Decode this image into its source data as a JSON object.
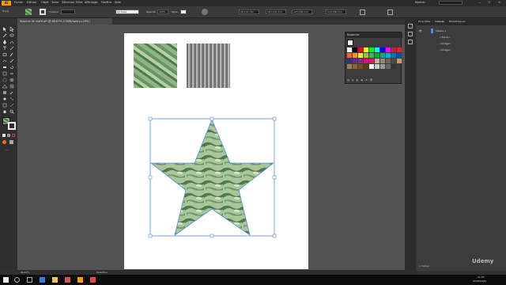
{
  "menubar": {
    "logo": "Ai",
    "items": [
      "Fichier",
      "Edition",
      "Objet",
      "Texte",
      "Sélection",
      "Effet",
      "Affichage",
      "Fenêtre",
      "Aide"
    ],
    "workspace": "Normal"
  },
  "controlbar": {
    "fill_label": "Contour",
    "stroke_style": "De base",
    "opacity_label": "Opacité",
    "opacity_value": "100%",
    "style_label": "Style",
    "x_value": "80,132 mm",
    "y_value": "163,152 mm",
    "w_value": "125,189 mm",
    "h_value": "120,280 mm"
  },
  "document": {
    "tab_title": "Nuance de motif.ai* @ 66,67% (CMJN/Aperçu GPU)",
    "zoom": "66,67%",
    "status_tool": "Sélection"
  },
  "swatches_panel": {
    "title": "Nuancier",
    "colors": [
      "#ffffff",
      "#000000",
      "#ff0000",
      "#ffff00",
      "#00ff00",
      "#00ffff",
      "#0000ff",
      "#ff00ff",
      "#c41e3a",
      "#ed1c24",
      "#f26522",
      "#f7941d",
      "#fff200",
      "#8dc63f",
      "#39b54a",
      "#00a651",
      "#00a99d",
      "#00aeef",
      "#0072bc",
      "#0054a6",
      "#2e3192",
      "#662d91",
      "#92278f",
      "#ec008c",
      "#ed145b",
      "#c7b299",
      "#998675",
      "#736357",
      "#534741",
      "#c69c6d",
      "#a67c52",
      "#8c6239",
      "#754c24",
      "#603913",
      "#ffffff",
      "#cccccc",
      "#999999",
      "#666666",
      "#333333"
    ]
  },
  "layers_panel": {
    "tabs": [
      "Propriétés",
      "Calques",
      "Bibliothèques"
    ],
    "layers": [
      "Calque 1",
      "<Tracé>",
      "<Image>",
      "<Image>"
    ],
    "footer": "1 Calque"
  },
  "taskbar": {
    "search_placeholder": "Rechercher",
    "time": "11:57",
    "date": "03/04/2021"
  },
  "colors": {
    "accent": "#ff9a00",
    "selection": "#4f8ee8"
  },
  "canvas": {
    "watermark": "Udemy"
  }
}
